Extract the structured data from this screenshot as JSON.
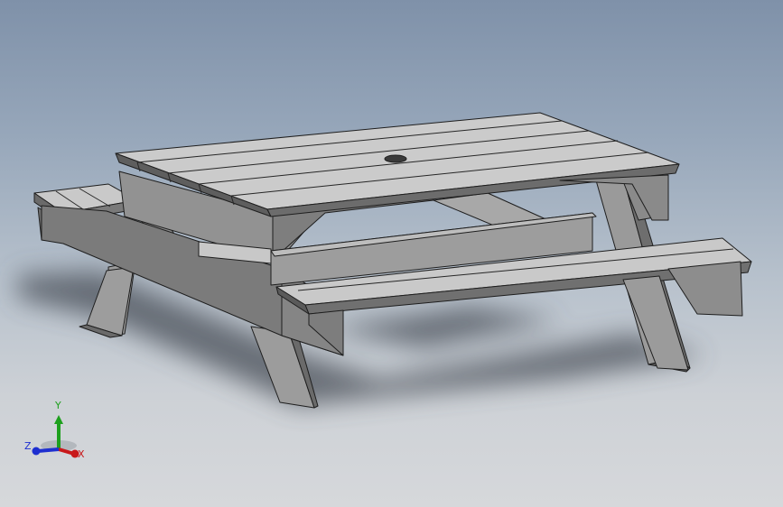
{
  "viewport": {
    "background_top": "#7f91a9",
    "background_bottom": "#d6d8db"
  },
  "model": {
    "part_color": "#8e8e8e",
    "edge_color": "#1e1e1e"
  },
  "triad": {
    "x_label": "X",
    "y_label": "Y",
    "z_label": "Z",
    "x_color": "#c8181a",
    "y_color": "#1da01d",
    "z_color": "#1e2fd0"
  }
}
